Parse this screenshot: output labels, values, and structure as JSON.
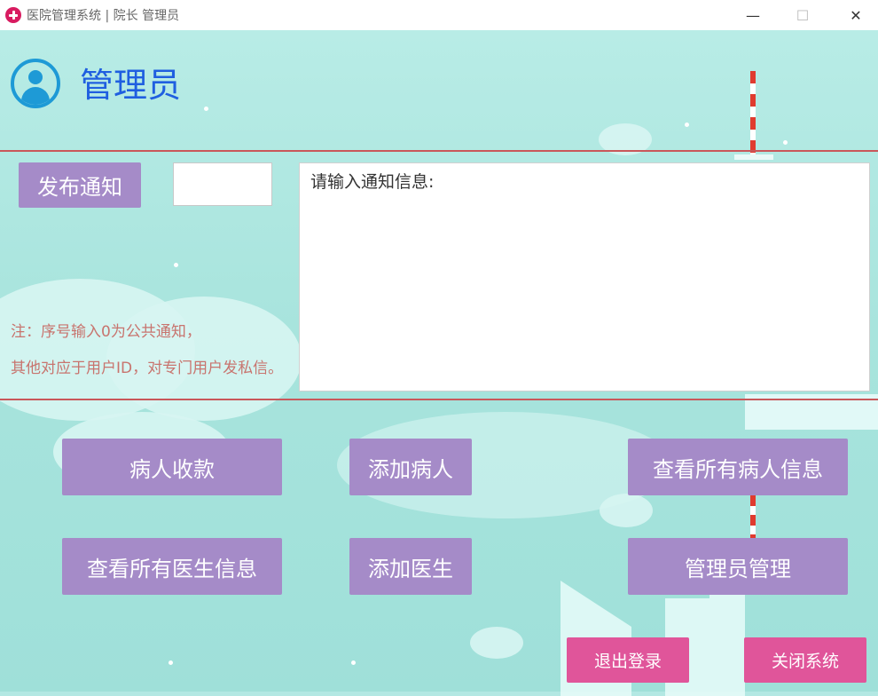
{
  "window": {
    "title": "医院管理系统 | 院长 管理员",
    "minimize_glyph": "—",
    "maximize_glyph": "☐",
    "close_glyph": "✕"
  },
  "header": {
    "role_title": "管理员",
    "avatar_icon": "user-avatar-icon"
  },
  "notice": {
    "publish_label": "发布通知",
    "id_value": "",
    "message_text": "请输入通知信息:",
    "note_line1": "注：序号输入0为公共通知，",
    "note_line2": "其他对应于用户ID，对专门用户发私信。"
  },
  "actions": {
    "collect_payment": "病人收款",
    "add_patient": "添加病人",
    "view_patients": "查看所有病人信息",
    "view_doctors": "查看所有医生信息",
    "add_doctor": "添加医生",
    "admin_manage": "管理员管理"
  },
  "footer": {
    "logout": "退出登录",
    "close_system": "关闭系统"
  },
  "colors": {
    "primary_button": "#a58bc8",
    "danger_button": "#e0559a",
    "title_blue": "#1f5fe0",
    "divider": "#c9575a",
    "background": "#b3e8e3"
  }
}
